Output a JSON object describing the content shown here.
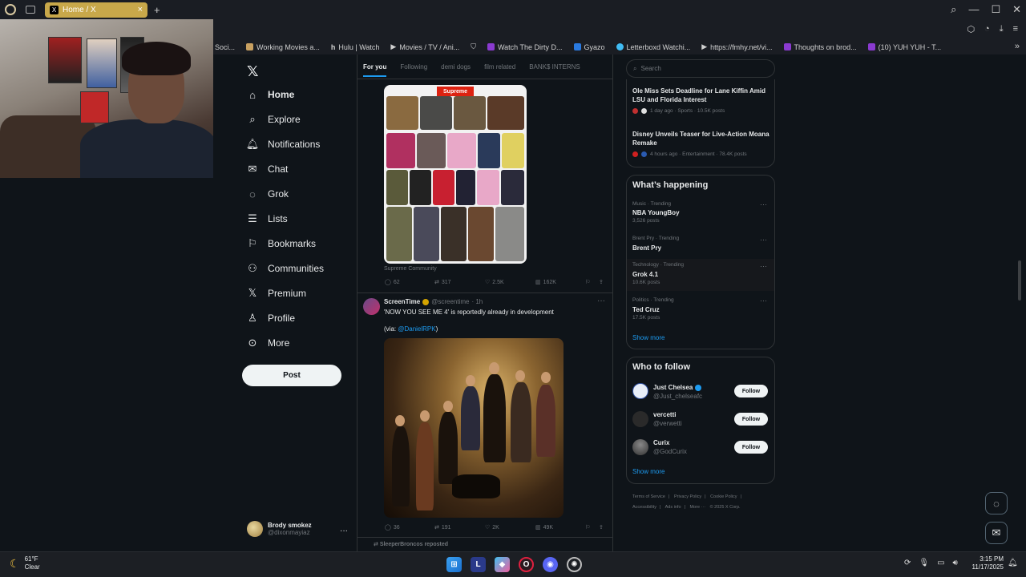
{
  "browser": {
    "tab_title": "Home / X",
    "tab_close": "×",
    "new_tab": "+",
    "bookmarks": [
      {
        "label": "Soci..."
      },
      {
        "label": "Working Movies a..."
      },
      {
        "label": "Hulu | Watch"
      },
      {
        "label": "Movies / TV / Ani..."
      },
      {
        "label": ""
      },
      {
        "label": "Watch The Dirty D..."
      },
      {
        "label": "Gyazo"
      },
      {
        "label": "Letterboxd Watchi..."
      },
      {
        "label": "https://fmhy.net/vi..."
      },
      {
        "label": "Thoughts on brod..."
      },
      {
        "label": "(10) YUH YUH - T..."
      }
    ]
  },
  "sidebar": {
    "logo": "𝕏",
    "items": [
      {
        "label": "Home",
        "icon": "home-icon"
      },
      {
        "label": "Explore",
        "icon": "search-icon"
      },
      {
        "label": "Notifications",
        "icon": "bell-icon"
      },
      {
        "label": "Chat",
        "icon": "mail-icon"
      },
      {
        "label": "Grok",
        "icon": "grok-icon"
      },
      {
        "label": "Lists",
        "icon": "list-icon"
      },
      {
        "label": "Bookmarks",
        "icon": "bookmark-icon"
      },
      {
        "label": "Communities",
        "icon": "people-icon"
      },
      {
        "label": "Premium",
        "icon": "x-icon"
      },
      {
        "label": "Profile",
        "icon": "person-icon"
      },
      {
        "label": "More",
        "icon": "more-circle-icon"
      }
    ],
    "post_label": "Post",
    "profile": {
      "name": "Brody smokez",
      "handle": "@dixonmayiaz",
      "more": "···"
    }
  },
  "timeline": {
    "tabs": [
      "For you",
      "Following",
      "demi dogs",
      "film related",
      "BANK$ INTERNS"
    ],
    "post1": {
      "image_brand": "Supreme",
      "caption": "Supreme Community",
      "replies": "62",
      "reposts": "317",
      "likes": "2.5K",
      "views": "162K"
    },
    "post2": {
      "name": "ScreenTime",
      "handle": "@screentime",
      "time": "· 1h",
      "text": "'NOW YOU SEE ME 4' is reportedly already in development",
      "via_prefix": "(via: ",
      "via_link": "@DanielRPK",
      "via_suffix": ")",
      "replies": "36",
      "reposts": "191",
      "likes": "2K",
      "views": "49K",
      "more": "···"
    },
    "repost_note": "SleeperBroncos reposted"
  },
  "right": {
    "search_placeholder": "Search",
    "news": [
      {
        "title": "Ole Miss Sets Deadline for Lane Kiffin Amid LSU and Florida Interest",
        "meta": "1 day ago · Sports · 10.5K posts"
      },
      {
        "title": "Disney Unveils Teaser for Live-Action Moana Remake",
        "meta": "4 hours ago · Entertainment · 78.4K posts"
      }
    ],
    "happening": {
      "title": "What’s happening",
      "trends": [
        {
          "category": "Music · Trending",
          "name": "NBA YoungBoy",
          "posts": "3,526 posts"
        },
        {
          "category": "Brent Pry · Trending",
          "name": "Brent Pry",
          "posts": ""
        },
        {
          "category": "Technology · Trending",
          "name": "Grok 4.1",
          "posts": "10.6K posts"
        },
        {
          "category": "Politics · Trending",
          "name": "Ted Cruz",
          "posts": "17.5K posts"
        }
      ],
      "show_more": "Show more"
    },
    "who_to_follow": {
      "title": "Who to follow",
      "users": [
        {
          "name": "Just Chelsea",
          "handle": "@Just_chelseafc",
          "button": "Follow",
          "verified": true
        },
        {
          "name": "vercetti",
          "handle": "@verwetti",
          "button": "Follow",
          "verified": false
        },
        {
          "name": "Curix",
          "handle": "@GodCurix",
          "button": "Follow",
          "verified": false
        }
      ],
      "show_more": "Show more"
    },
    "footer": [
      "Terms of Service",
      "|",
      "Privacy Policy",
      "|",
      "Cookie Policy",
      "|",
      "Accessibility",
      "|",
      "Ads info",
      "|",
      "More ···",
      "© 2025 X Corp."
    ]
  },
  "taskbar": {
    "temperature": "61°F",
    "condition": "Clear",
    "time": "3:15 PM",
    "date": "11/17/2025"
  }
}
